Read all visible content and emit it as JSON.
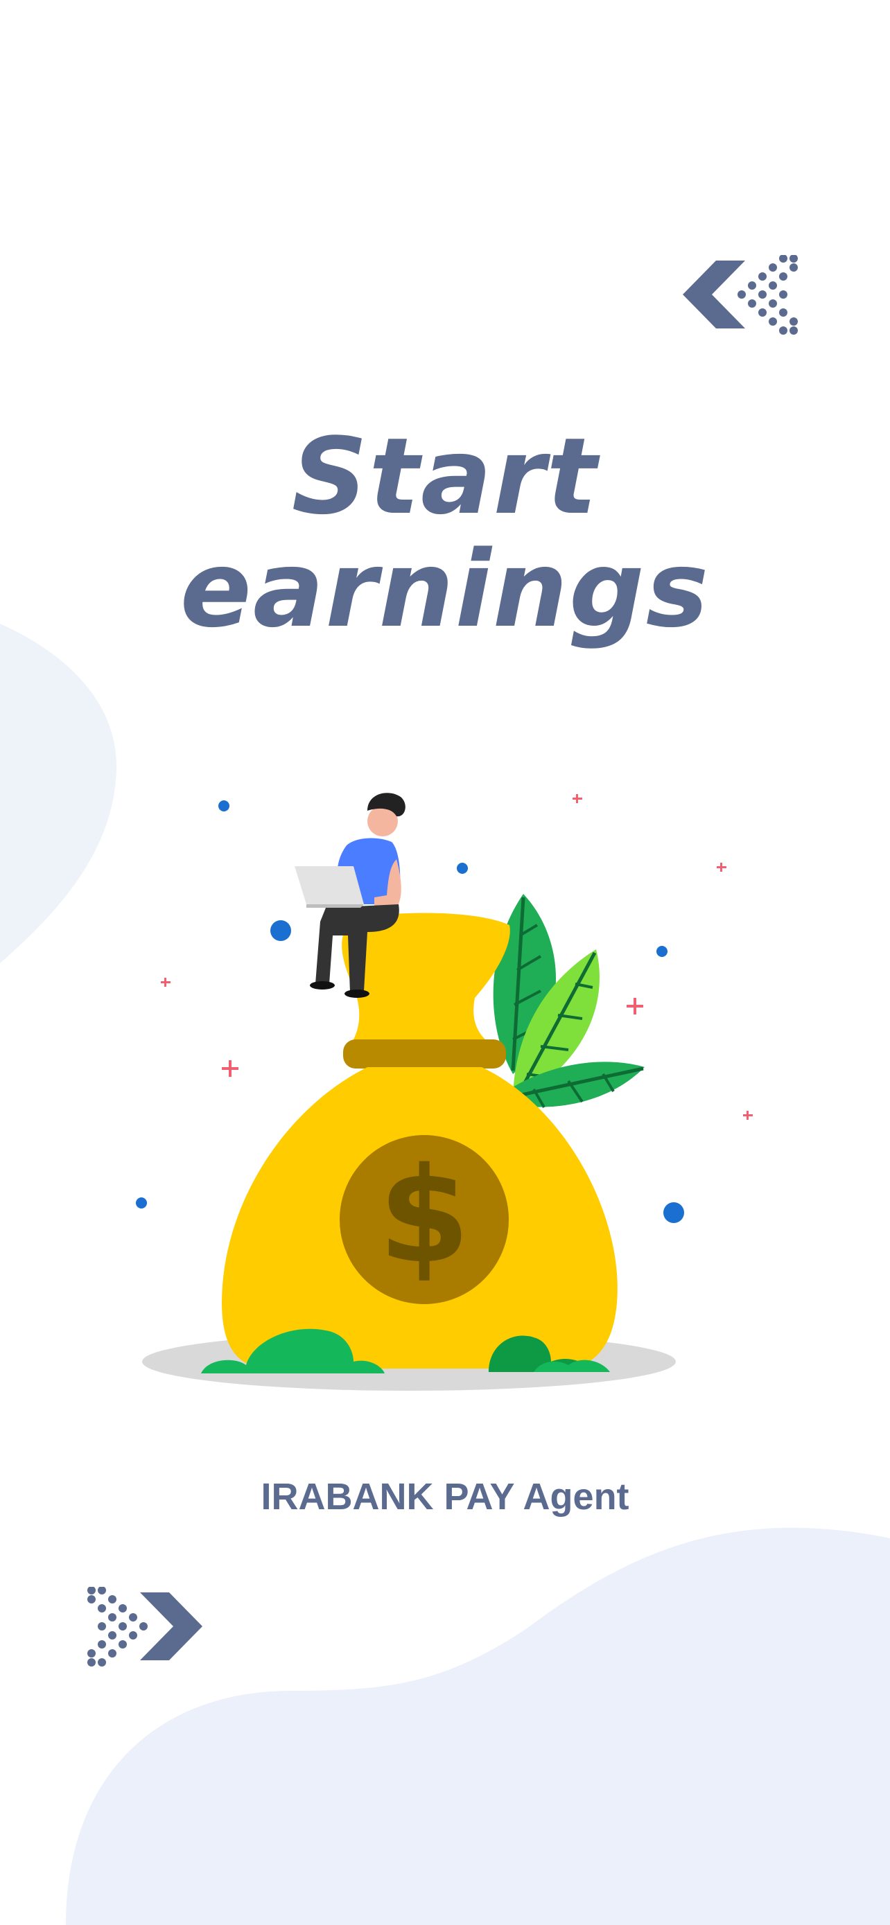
{
  "screen": {
    "title_line_1": "Start",
    "title_line_2": "earnings",
    "brand_label": "IRABANK PAY Agent"
  },
  "navigation": {
    "back_icon": "double-chevron-left-icon",
    "next_icon": "double-chevron-right-icon"
  },
  "illustration": {
    "subject": "money-bag-with-person-illustration",
    "symbol": "$"
  },
  "colors": {
    "title": "#5b6a8f",
    "bag": "#ffcc00",
    "coin": "#a97c00",
    "blob_left": "#eef3fa",
    "blob_bottom": "#ebf0fb"
  }
}
